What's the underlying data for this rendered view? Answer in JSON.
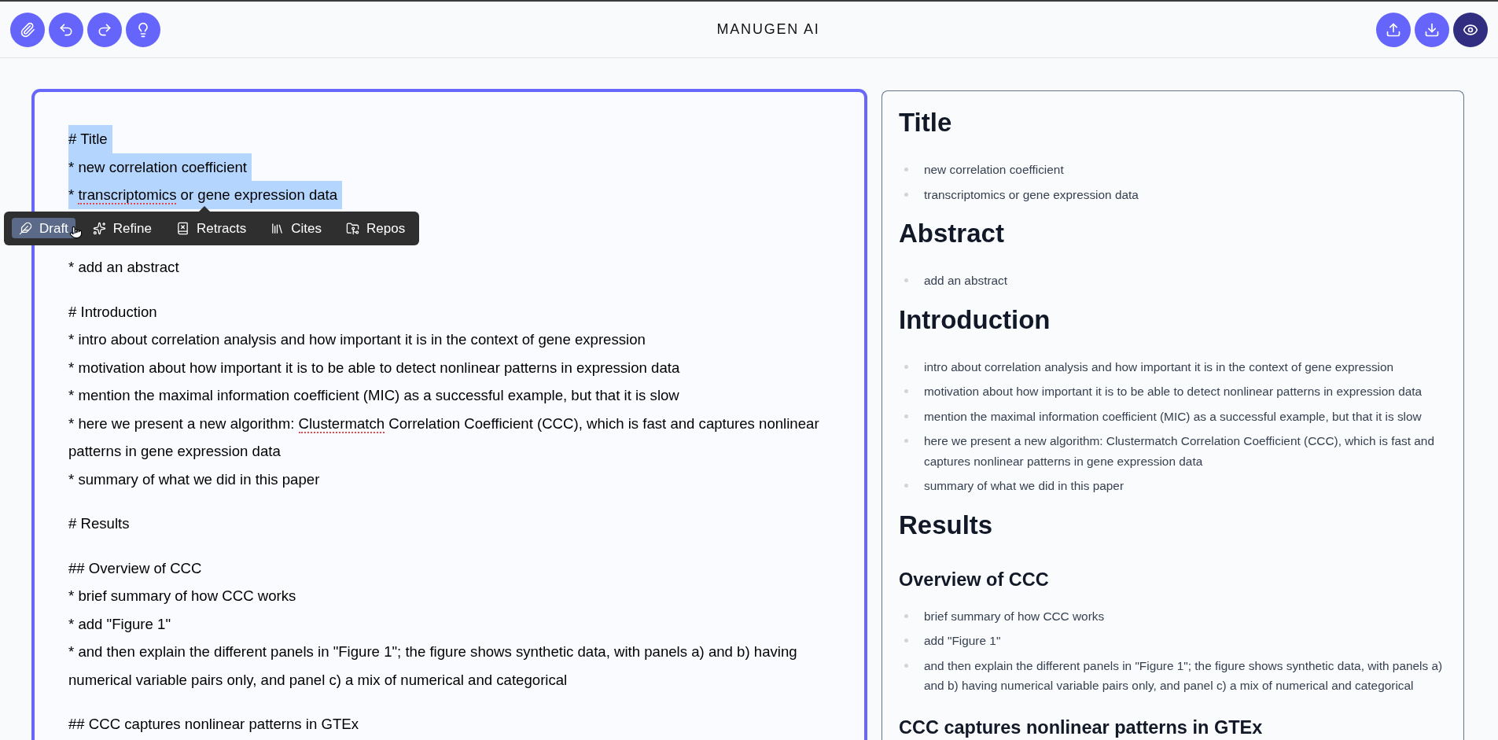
{
  "header": {
    "title": "MANUGEN AI",
    "preview_toggle": {
      "on": true
    }
  },
  "editor": {
    "paragraphs": [
      {
        "lines": [
          {
            "text": "# Title",
            "selected": true
          },
          {
            "text": "* new correlation coefficient",
            "selected": true
          },
          {
            "parts": [
              {
                "text": "* ",
                "misspelled": false
              },
              {
                "text": "transcriptomics",
                "misspelled": true
              },
              {
                "text": " or gene expression data",
                "misspelled": false
              }
            ],
            "selected": true
          }
        ]
      },
      {
        "lines": [
          {
            "text": "* add an abstract",
            "selected": false
          }
        ]
      },
      {
        "lines": [
          {
            "text": "# Introduction",
            "selected": false
          },
          {
            "text": "* intro about correlation analysis and how important it is in the context of gene expression",
            "selected": false
          },
          {
            "text": "* motivation about how important it is to be able to detect nonlinear patterns in expression data",
            "selected": false
          },
          {
            "text": "* mention the maximal information coefficient (MIC) as a successful example, but that it is slow",
            "selected": false
          },
          {
            "parts": [
              {
                "text": "* here we present a new algorithm: ",
                "misspelled": false
              },
              {
                "text": "Clustermatch",
                "misspelled": true
              },
              {
                "text": " Correlation Coefficient (CCC), which is fast and captures nonlinear patterns in gene expression data",
                "misspelled": false
              }
            ],
            "selected": false
          },
          {
            "text": "* summary of what we did in this paper",
            "selected": false
          }
        ]
      },
      {
        "lines": [
          {
            "text": "# Results",
            "selected": false
          }
        ]
      },
      {
        "lines": [
          {
            "text": "## Overview of CCC",
            "selected": false
          },
          {
            "text": "* brief summary of how CCC works",
            "selected": false
          },
          {
            "text": "* add \"Figure 1\"",
            "selected": false
          },
          {
            "text": "* and then explain the different panels in \"Figure 1\"; the figure shows synthetic data, with panels a) and b) having numerical variable pairs only, and panel c) a mix of numerical and categorical",
            "selected": false
          }
        ]
      },
      {
        "lines": [
          {
            "text": "## CCC captures nonlinear patterns in GTEx",
            "selected": false
          }
        ]
      }
    ],
    "toolbar": {
      "items": [
        {
          "label": "Draft",
          "selected": true,
          "hovered": true
        },
        {
          "label": "Refine",
          "selected": false,
          "hovered": false
        },
        {
          "label": "Retracts",
          "selected": false,
          "hovered": false
        },
        {
          "label": "Cites",
          "selected": false,
          "hovered": false
        },
        {
          "label": "Repos",
          "selected": false,
          "hovered": false
        }
      ]
    }
  },
  "preview": {
    "sections": [
      {
        "kind": "h1",
        "heading": "Title",
        "items": [
          "new correlation coefficient",
          "transcriptomics or gene expression data"
        ]
      },
      {
        "kind": "h1",
        "heading": "Abstract",
        "items": [
          "add an abstract"
        ]
      },
      {
        "kind": "h1",
        "heading": "Introduction",
        "items": [
          "intro about correlation analysis and how important it is in the context of gene expression",
          "motivation about how important it is to be able to detect nonlinear patterns in expression data",
          "mention the maximal information coefficient (MIC) as a successful example, but that it is slow",
          "here we present a new algorithm: Clustermatch Correlation Coefficient (CCC), which is fast and captures nonlinear patterns in gene expression data",
          "summary of what we did in this paper"
        ]
      },
      {
        "kind": "h1",
        "heading": "Results"
      },
      {
        "kind": "h2",
        "heading": "Overview of CCC",
        "items": [
          "brief summary of how CCC works",
          "add \"Figure 1\"",
          "and then explain the different panels in \"Figure 1\"; the figure shows synthetic data, with panels a) and b) having numerical variable pairs only, and panel c) a mix of numerical and categorical"
        ]
      },
      {
        "kind": "h2",
        "heading": "CCC captures nonlinear patterns in GTEx"
      }
    ]
  }
}
